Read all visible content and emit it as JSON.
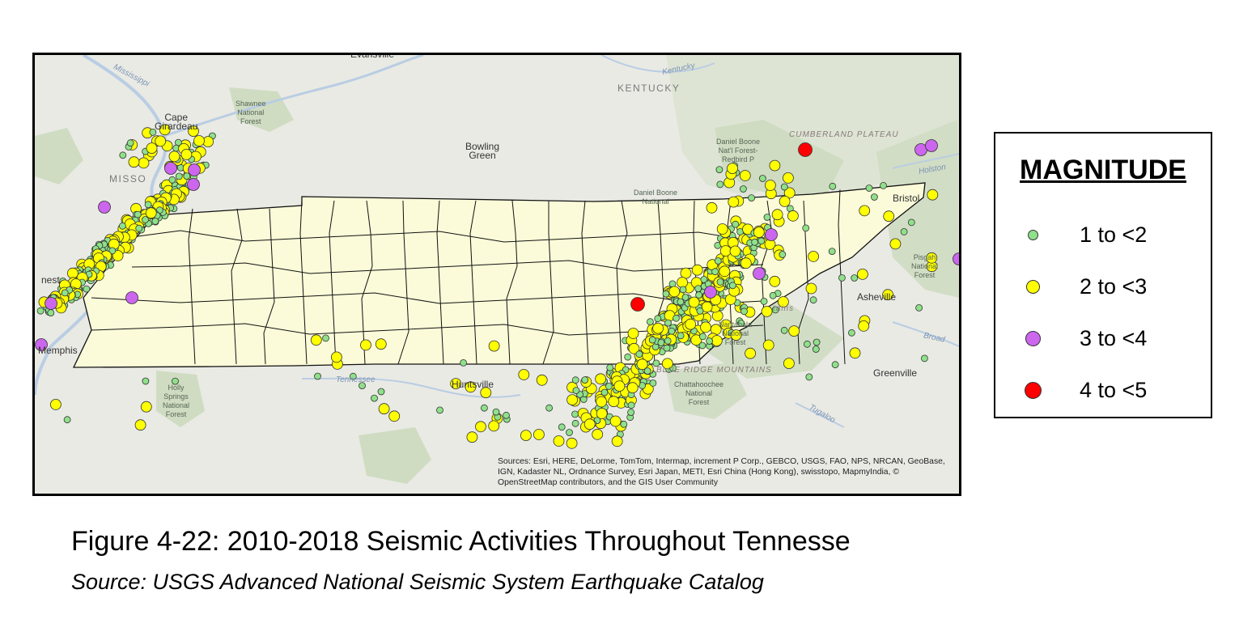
{
  "map": {
    "labels": [
      {
        "id": "evansville",
        "text": "Evansville",
        "kind": "city"
      },
      {
        "id": "mississippi",
        "text": "Mississippi",
        "kind": "water"
      },
      {
        "id": "kentucky-river",
        "text": "Kentucky",
        "kind": "water"
      },
      {
        "id": "kentucky",
        "text": "KENTUCKY",
        "kind": "state"
      },
      {
        "id": "shawnee",
        "text": "Shawnee\nNational\nForest",
        "kind": "park"
      },
      {
        "id": "cape-girardeau",
        "text": "Cape\nGirardeau",
        "kind": "city"
      },
      {
        "id": "bowling-green",
        "text": "Bowling\nGreen",
        "kind": "city"
      },
      {
        "id": "daniel-boone-1",
        "text": "Daniel Boone\nNat'l Forest-\nRedbird P",
        "kind": "park"
      },
      {
        "id": "cumberland-plateau",
        "text": "CUMBERLAND PLATEAU",
        "kind": "region"
      },
      {
        "id": "holston",
        "text": "Holston",
        "kind": "water"
      },
      {
        "id": "missouri",
        "text": "MISSO",
        "kind": "state"
      },
      {
        "id": "daniel-boone-2",
        "text": "Daniel Boone\nNational",
        "kind": "park"
      },
      {
        "id": "bristol",
        "text": "Bristol",
        "kind": "city"
      },
      {
        "id": "pisgah",
        "text": "Pisgah\nNational\nForest",
        "kind": "park"
      },
      {
        "id": "forrest",
        "text": "nest",
        "kind": "city"
      },
      {
        "id": "asheville",
        "text": "Asheville",
        "kind": "city"
      },
      {
        "id": "smoky",
        "text": "tains",
        "kind": "region"
      },
      {
        "id": "memphis",
        "text": "Memphis",
        "kind": "city"
      },
      {
        "id": "broad",
        "text": "Broad",
        "kind": "water"
      },
      {
        "id": "nantahala",
        "text": "Nantahala\nNational\nForest",
        "kind": "park"
      },
      {
        "id": "blue-ridge",
        "text": "BLUE RIDGE MOUNTAINS",
        "kind": "region"
      },
      {
        "id": "tennessee-river",
        "text": "Tennessee",
        "kind": "water"
      },
      {
        "id": "huntsville",
        "text": "Huntsville",
        "kind": "city"
      },
      {
        "id": "greenville",
        "text": "Greenville",
        "kind": "city"
      },
      {
        "id": "holly-springs",
        "text": "Holly\nSprings\nNational\nForest",
        "kind": "park"
      },
      {
        "id": "chattahoochee",
        "text": "Chattahoochee\nNational\nForest",
        "kind": "park"
      },
      {
        "id": "tugaloo",
        "text": "Tugaloo",
        "kind": "water"
      }
    ],
    "attribution": "Sources: Esri, HERE, DeLorme, TomTom, Intermap, increment P Corp., GEBCO, USGS, FAO, NPS, NRCAN, GeoBase, IGN, Kadaster NL, Ordnance Survey, Esri Japan, METI, Esri China (Hong Kong), swisstopo, MapmyIndia, © OpenStreetMap contributors, and the GIS User Community",
    "colors": {
      "water": "#b9cde3",
      "land": "#e9eae4",
      "forest": "#cfdcc2",
      "tennessee": "#fbfbd9",
      "county_line": "#111111",
      "mag_1_2": "#8fe08a",
      "mag_2_3": "#ffff00",
      "mag_3_4": "#cc66ee",
      "mag_4_5": "#ff0000"
    }
  },
  "legend": {
    "title": "MAGNITUDE",
    "items": [
      {
        "label": "1 to <2",
        "color": "#8fe08a"
      },
      {
        "label": "2 to <3",
        "color": "#ffff00"
      },
      {
        "label": "3 to <4",
        "color": "#cc66ee"
      },
      {
        "label": "4 to <5",
        "color": "#ff0000"
      }
    ]
  },
  "caption": {
    "title": "Figure 4-22: 2010-2018 Seismic Activities Throughout Tennesse",
    "source": "Source: USGS Advanced National Seismic System Earthquake Catalog"
  }
}
